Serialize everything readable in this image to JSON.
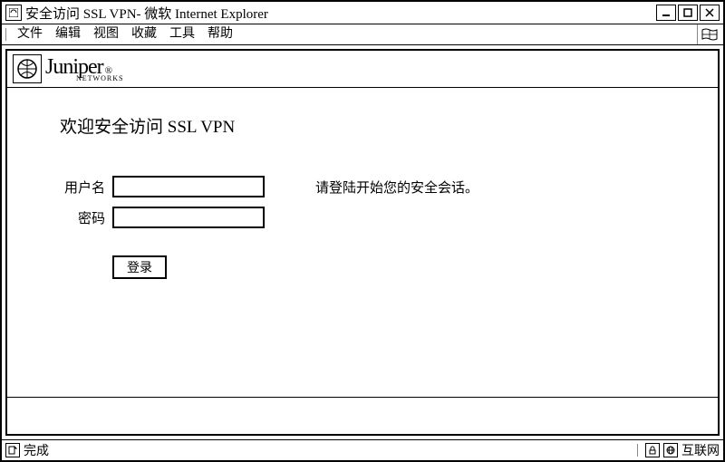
{
  "window": {
    "title": "安全访问 SSL VPN- 微软 Internet Explorer"
  },
  "menu": {
    "file": "文件",
    "edit": "编辑",
    "view": "视图",
    "favorites": "收藏",
    "tools": "工具",
    "help": "帮助"
  },
  "brand": {
    "name": "Juniper",
    "reg": "®",
    "sub": "NETWORKS"
  },
  "page": {
    "heading": "欢迎安全访问 SSL VPN",
    "username_label": "用户名",
    "password_label": "密码",
    "hint": "请登陆开始您的安全会话。",
    "login_button": "登录",
    "username_value": "",
    "password_value": ""
  },
  "status": {
    "done": "完成",
    "zone": "互联网"
  }
}
